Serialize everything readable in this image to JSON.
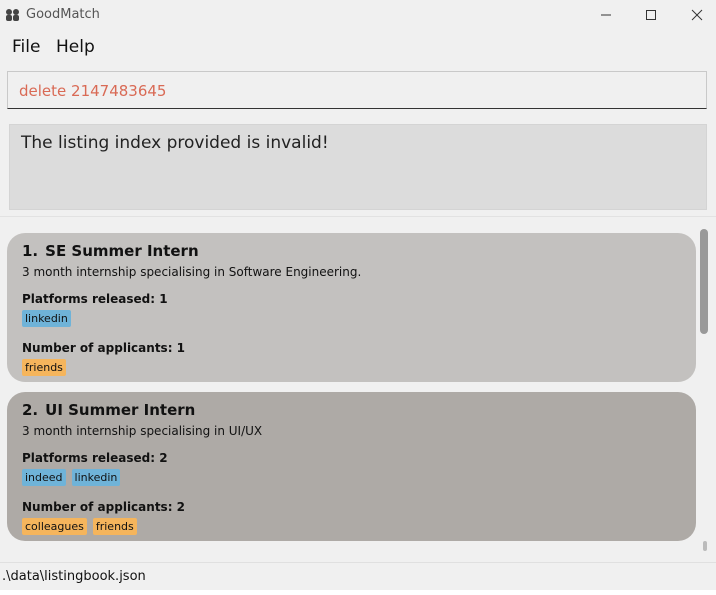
{
  "window": {
    "title": "GoodMatch",
    "minimize_icon": "minimize-icon",
    "maximize_icon": "maximize-icon",
    "close_icon": "close-icon"
  },
  "menu": {
    "items": [
      {
        "label": "File"
      },
      {
        "label": "Help"
      }
    ]
  },
  "command_box": {
    "value": "delete 2147483645",
    "text_color": "#d96a55"
  },
  "result_display": {
    "message": "The listing index provided is invalid!"
  },
  "listings": [
    {
      "index": "1.",
      "title": "SE Summer Intern",
      "description": "3 month internship specialising in Software Engineering.",
      "platforms_label": "Platforms released: 1",
      "platforms": [
        "linkedin"
      ],
      "applicants_label": "Number of applicants: 1",
      "applicants": [
        "friends"
      ]
    },
    {
      "index": "2.",
      "title": "UI Summer Intern",
      "description": "3 month internship specialising in UI/UX",
      "platforms_label": "Platforms released: 2",
      "platforms": [
        "indeed",
        "linkedin"
      ],
      "applicants_label": "Number of applicants: 2",
      "applicants": [
        "colleagues",
        "friends"
      ]
    }
  ],
  "status_bar": {
    "path": ".\\data\\listingbook.json"
  },
  "colors": {
    "platform_tag": "#6fb3d8",
    "applicant_tag": "#f5b55c",
    "card_1": "#c3c1bf",
    "card_2": "#aeaaa6"
  }
}
